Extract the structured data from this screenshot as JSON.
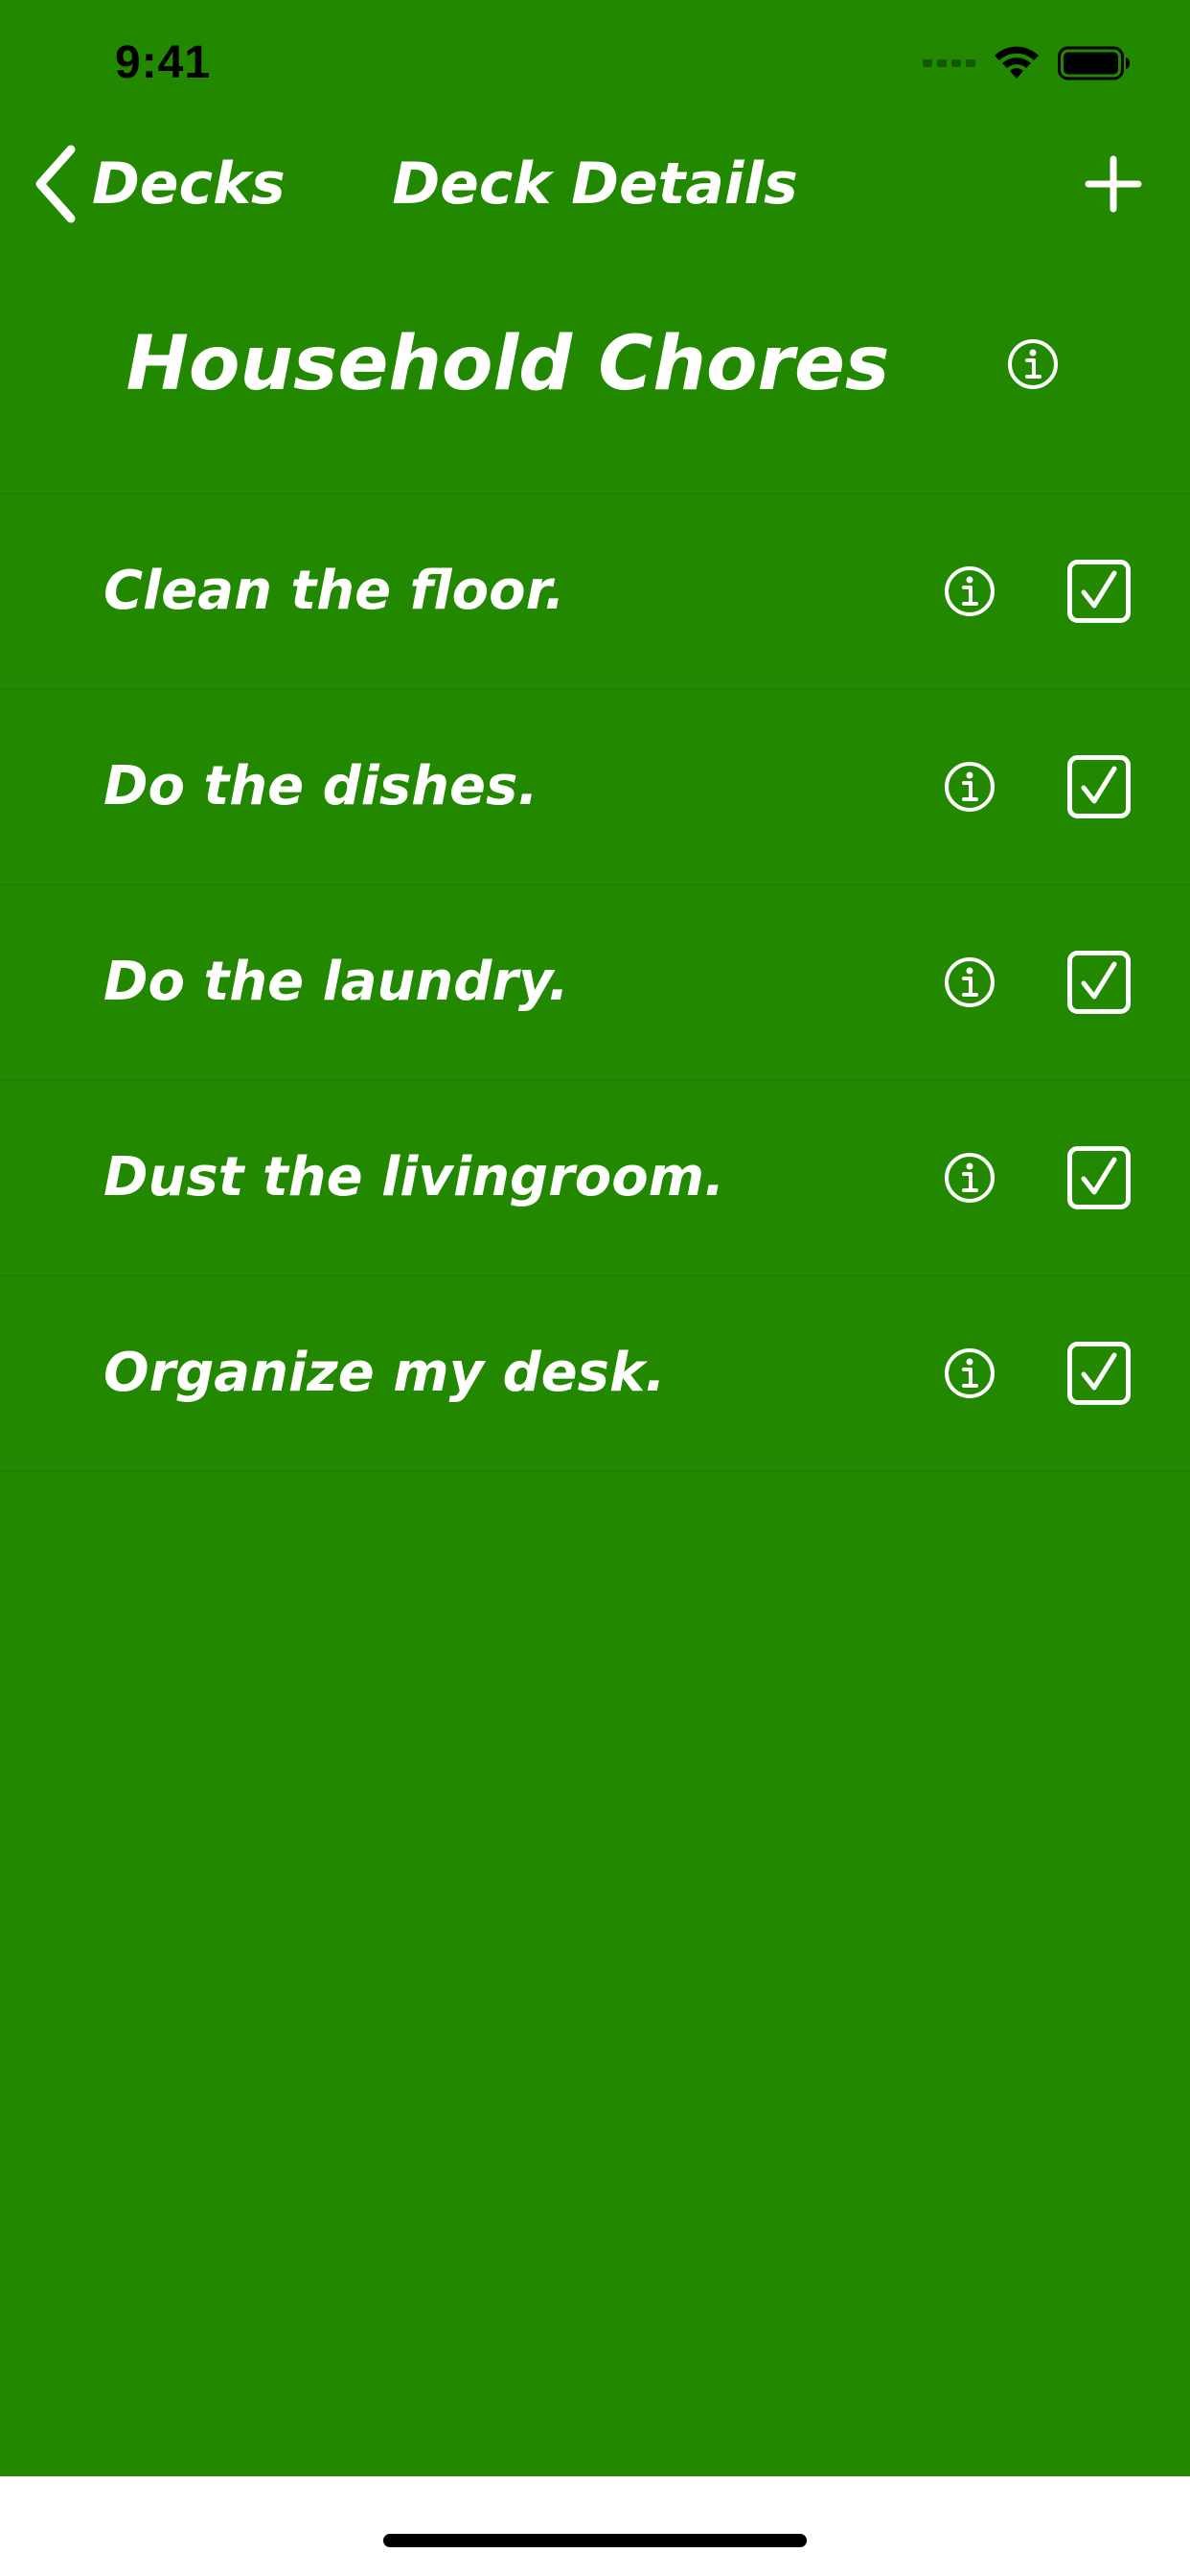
{
  "status_bar": {
    "time": "9:41",
    "icons": [
      "signal-icon",
      "wifi-icon",
      "battery-icon"
    ]
  },
  "nav": {
    "back_label": "Decks",
    "title": "Deck Details",
    "back_icon": "chevron-left-icon",
    "add_icon": "plus-icon"
  },
  "deck": {
    "title": "Household Chores",
    "info_icon": "info-icon"
  },
  "items": [
    {
      "label": "Clean the floor.",
      "checked": true
    },
    {
      "label": "Do the dishes.",
      "checked": true
    },
    {
      "label": "Do the laundry.",
      "checked": true
    },
    {
      "label": "Dust the livingroom.",
      "checked": true
    },
    {
      "label": "Organize my desk.",
      "checked": true
    }
  ],
  "colors": {
    "background": "#228800",
    "foreground": "#ffffff",
    "home_bar": "#000000"
  }
}
